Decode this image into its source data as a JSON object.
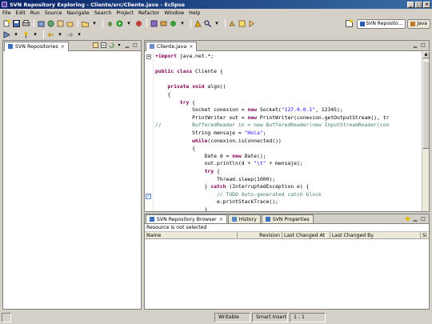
{
  "window": {
    "title": "SVN Repository Exploring - Cliente/src/Cliente.java - Eclipse",
    "buttons": [
      "_",
      "□",
      "×"
    ]
  },
  "menu": [
    "File",
    "Edit",
    "Run",
    "Source",
    "Navigate",
    "Search",
    "Project",
    "Refactor",
    "Window",
    "Help"
  ],
  "perspectives": [
    {
      "label": "SVN Reposito...",
      "icon": "svn-icon",
      "active": true
    },
    {
      "label": "Java",
      "icon": "java-icon",
      "active": false
    }
  ],
  "left_view": {
    "tab_label": "SVN Repositories",
    "close": "×"
  },
  "editor": {
    "tab_label": "Cliente.java",
    "close": "×",
    "lines": [
      [
        {
          "t": "+",
          "c": "kw"
        },
        {
          "t": "import",
          "c": "kw"
        },
        {
          "t": " java.net.*;"
        }
      ],
      [
        {
          "t": ""
        }
      ],
      [
        {
          "t": "public",
          "c": "kw"
        },
        {
          "t": " "
        },
        {
          "t": "class",
          "c": "kw"
        },
        {
          "t": " Cliente {"
        }
      ],
      [
        {
          "t": ""
        }
      ],
      [
        {
          "t": "    "
        },
        {
          "t": "private",
          "c": "kw"
        },
        {
          "t": " "
        },
        {
          "t": "void",
          "c": "kw"
        },
        {
          "t": " algo()"
        }
      ],
      [
        {
          "t": "    {"
        }
      ],
      [
        {
          "t": "        "
        },
        {
          "t": "try",
          "c": "kw"
        },
        {
          "t": " {"
        }
      ],
      [
        {
          "t": "            Socket conexion = "
        },
        {
          "t": "new",
          "c": "kw"
        },
        {
          "t": " Socket("
        },
        {
          "t": "\"127.0.0.1\"",
          "c": "str"
        },
        {
          "t": ", 12345);"
        }
      ],
      [
        {
          "t": "            PrintWriter out = "
        },
        {
          "t": "new",
          "c": "kw"
        },
        {
          "t": " PrintWriter(conexion.getOutputStream(), tr"
        }
      ],
      [
        {
          "t": "//          BufferedReader in = new BufferedReader(new InputStreamReader(con",
          "c": "cmt"
        }
      ],
      [
        {
          "t": "            String mensaje = "
        },
        {
          "t": "\"Hola\"",
          "c": "str"
        },
        {
          "t": ";"
        }
      ],
      [
        {
          "t": "            "
        },
        {
          "t": "while",
          "c": "kw"
        },
        {
          "t": "(conexion.isConnected())"
        }
      ],
      [
        {
          "t": "            {"
        }
      ],
      [
        {
          "t": "                Date d = "
        },
        {
          "t": "new",
          "c": "kw"
        },
        {
          "t": " Date();"
        }
      ],
      [
        {
          "t": "                out.println(d + "
        },
        {
          "t": "\"\\t\"",
          "c": "str"
        },
        {
          "t": " + mensaje);"
        }
      ],
      [
        {
          "t": "                "
        },
        {
          "t": "try",
          "c": "kw"
        },
        {
          "t": " {"
        }
      ],
      [
        {
          "t": "                    Thread.sleep(1000);"
        }
      ],
      [
        {
          "t": "                } "
        },
        {
          "t": "catch",
          "c": "kw"
        },
        {
          "t": " (InterruptedException e) {"
        }
      ],
      [
        {
          "t": "                    // TODO Auto-generated catch block",
          "c": "cmt"
        }
      ],
      [
        {
          "t": "                    e.printStackTrace();"
        }
      ],
      [
        {
          "t": "                }"
        }
      ]
    ]
  },
  "bottom_view": {
    "tabs": [
      {
        "label": "SVN Repository Browser",
        "active": true,
        "close": "×"
      },
      {
        "label": "History",
        "active": false
      },
      {
        "label": "SVN Properties",
        "active": false
      }
    ],
    "status_text": "Resource is not selected",
    "columns": [
      "Name",
      "Revision",
      "Last Changed At",
      "Last Changed By",
      "Si"
    ]
  },
  "statusbar": {
    "writable": "Writable",
    "insert_mode": "Smart Insert",
    "position": "1 : 1"
  },
  "colors": {
    "keyword": "#7f0055",
    "string": "#2a00ff",
    "comment": "#3f7f5f"
  }
}
